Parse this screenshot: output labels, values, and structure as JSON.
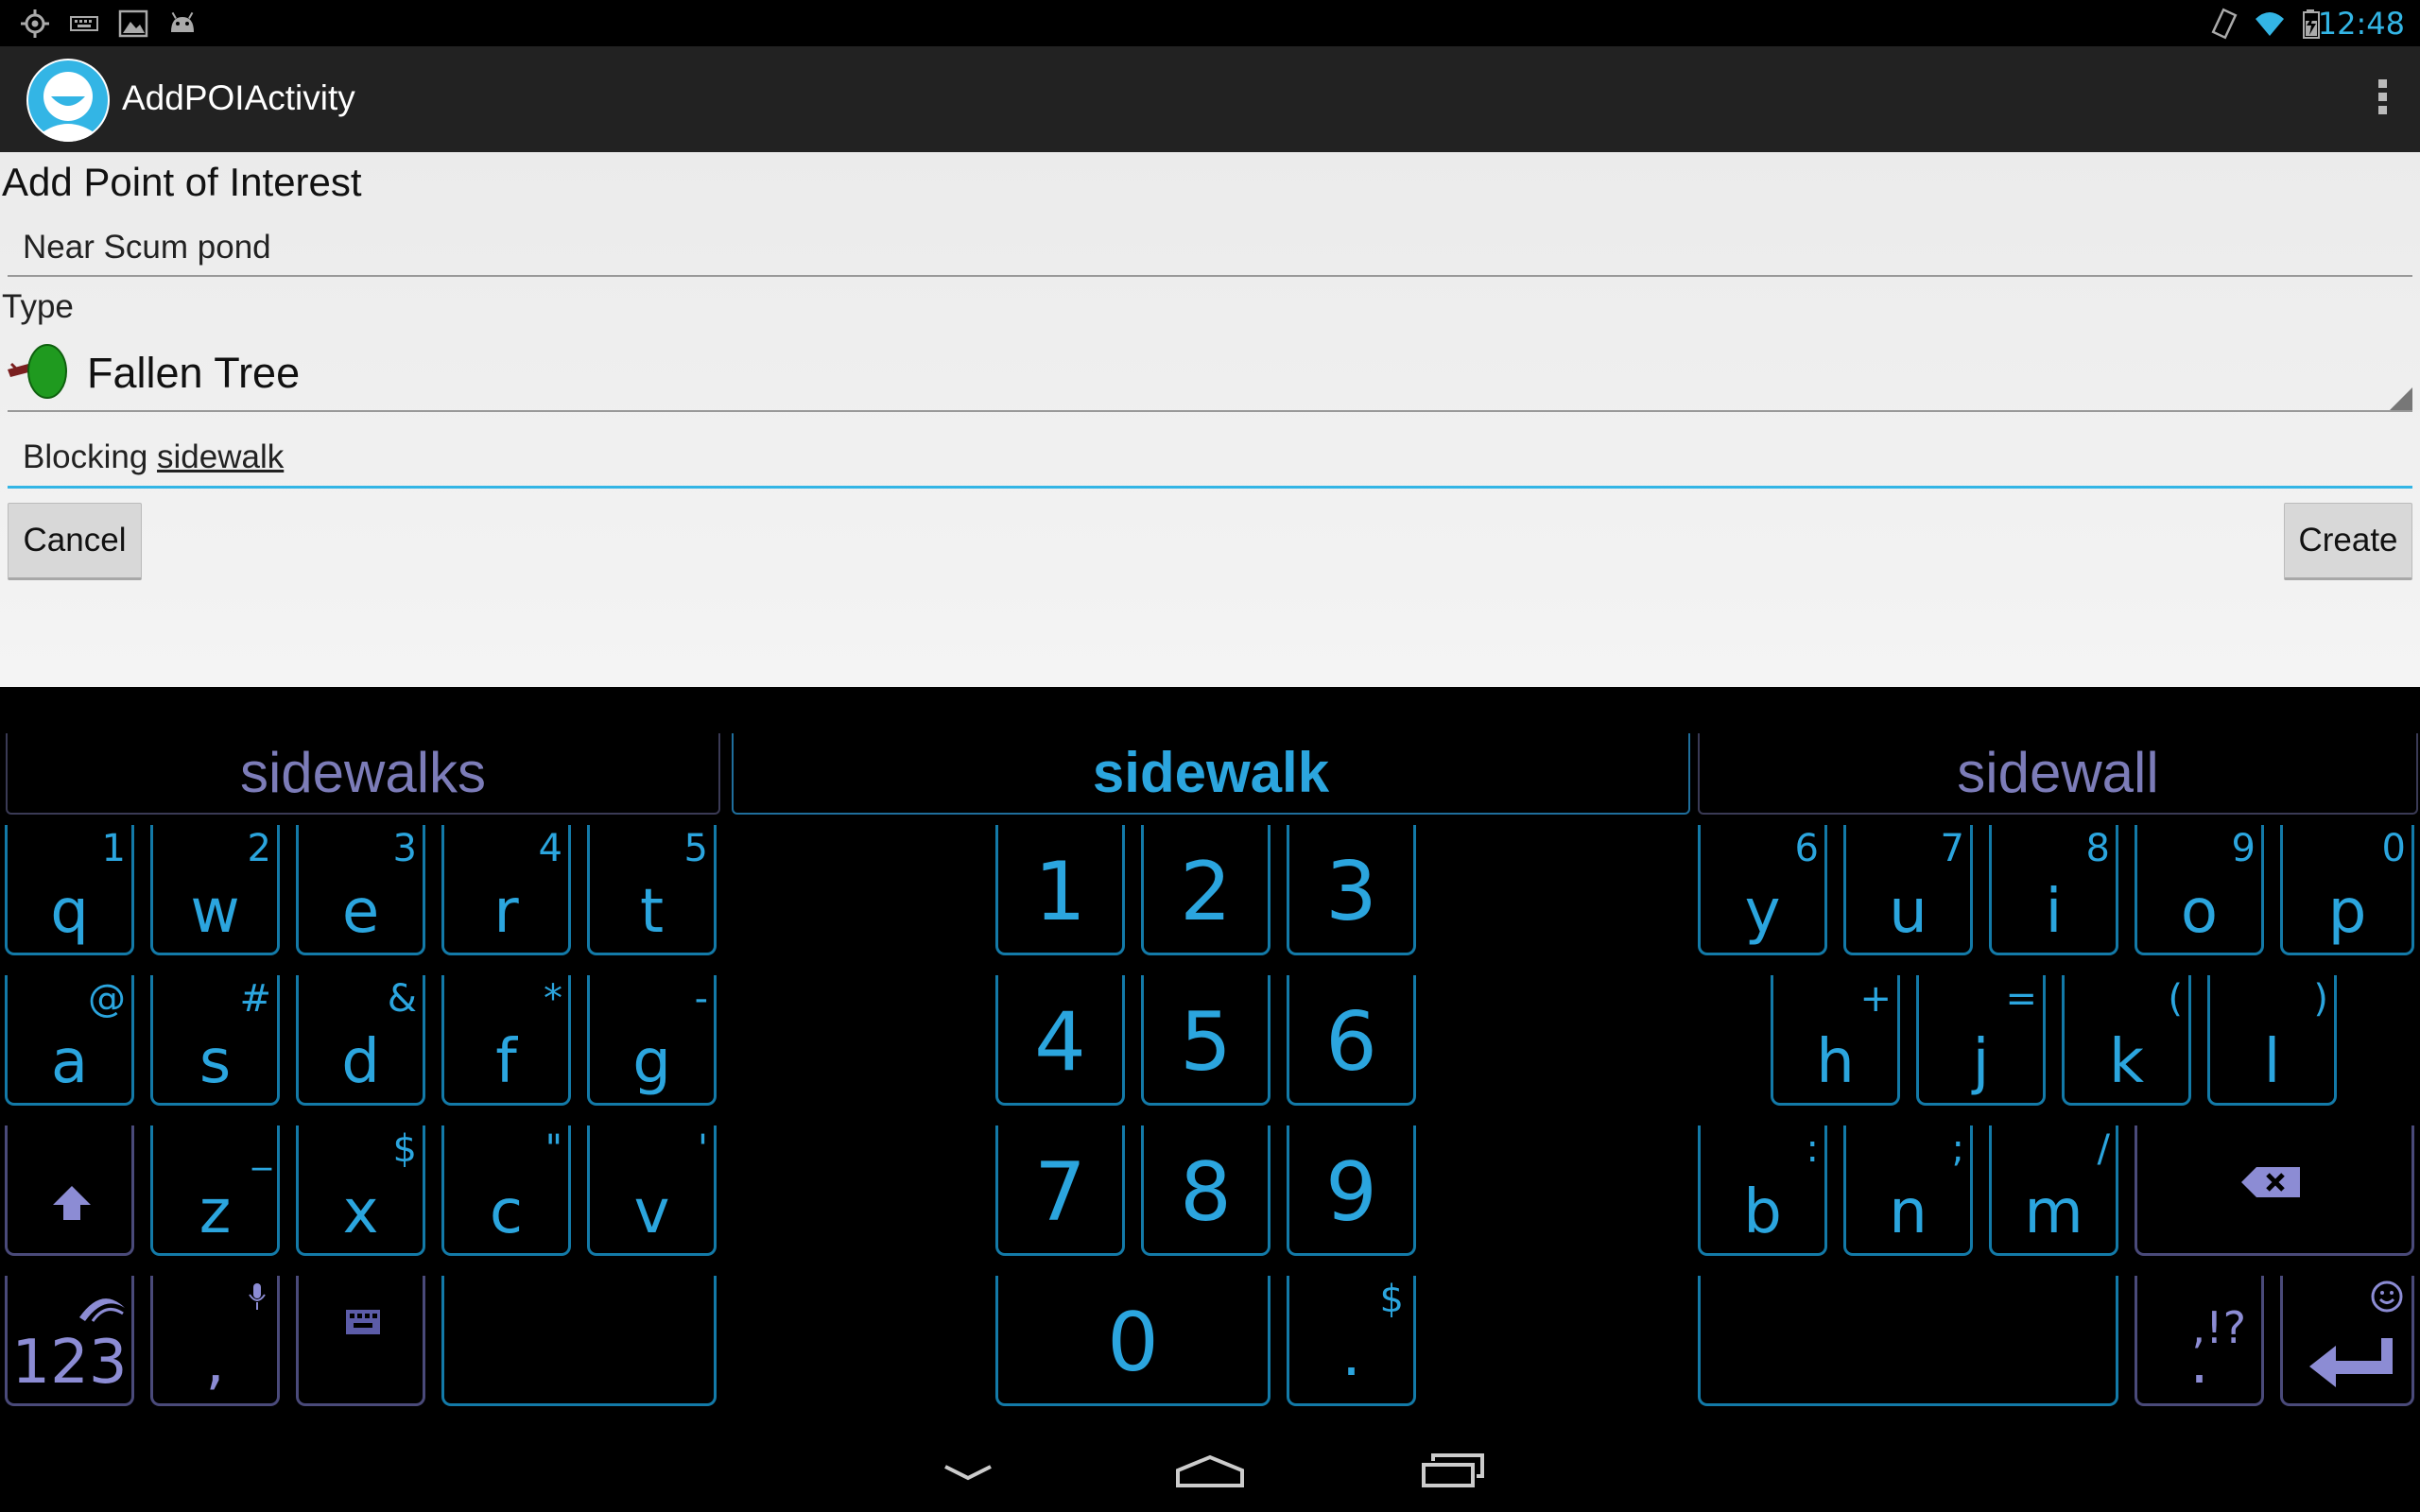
{
  "status_bar": {
    "time": "12:48"
  },
  "action_bar": {
    "title": "AddPOIActivity"
  },
  "form": {
    "heading": "Add Point of Interest",
    "name_value": "Near Scum pond",
    "type_label": "Type",
    "type_value": "Fallen Tree",
    "description_prefix": "Blocking ",
    "description_word": "sidewalk",
    "cancel_label": "Cancel",
    "create_label": "Create"
  },
  "keyboard": {
    "suggestions": [
      "sidewalks",
      "sidewalk",
      "sidewall"
    ],
    "row1_left": [
      {
        "label": "q",
        "sub": "1"
      },
      {
        "label": "w",
        "sub": "2"
      },
      {
        "label": "e",
        "sub": "3"
      },
      {
        "label": "r",
        "sub": "4"
      },
      {
        "label": "t",
        "sub": "5"
      }
    ],
    "row2_left": [
      {
        "label": "a",
        "sub": "@"
      },
      {
        "label": "s",
        "sub": "#"
      },
      {
        "label": "d",
        "sub": "&"
      },
      {
        "label": "f",
        "sub": "*"
      },
      {
        "label": "g",
        "sub": "-"
      }
    ],
    "row3_left": [
      {
        "label": "z",
        "sub": "_"
      },
      {
        "label": "x",
        "sub": "$"
      },
      {
        "label": "c",
        "sub": "\""
      },
      {
        "label": "v",
        "sub": "'"
      }
    ],
    "row4_left": {
      "numbers": "123",
      "comma": ","
    },
    "numpad": [
      "1",
      "2",
      "3",
      "4",
      "5",
      "6",
      "7",
      "8",
      "9"
    ],
    "numpad_zero": "0",
    "numpad_dot": ".",
    "numpad_dot_sub": "$",
    "row1_right": [
      {
        "label": "y",
        "sub": "6"
      },
      {
        "label": "u",
        "sub": "7"
      },
      {
        "label": "i",
        "sub": "8"
      },
      {
        "label": "o",
        "sub": "9"
      },
      {
        "label": "p",
        "sub": "0"
      }
    ],
    "row2_right": [
      {
        "label": "h",
        "sub": "+"
      },
      {
        "label": "j",
        "sub": "="
      },
      {
        "label": "k",
        "sub": "("
      },
      {
        "label": "l",
        "sub": ")"
      }
    ],
    "row3_right": [
      {
        "label": "b",
        "sub": ":"
      },
      {
        "label": "n",
        "sub": ";"
      },
      {
        "label": "m",
        "sub": "/"
      }
    ],
    "row4_right": {
      "period": ".",
      "period_sub": ",!?"
    }
  }
}
